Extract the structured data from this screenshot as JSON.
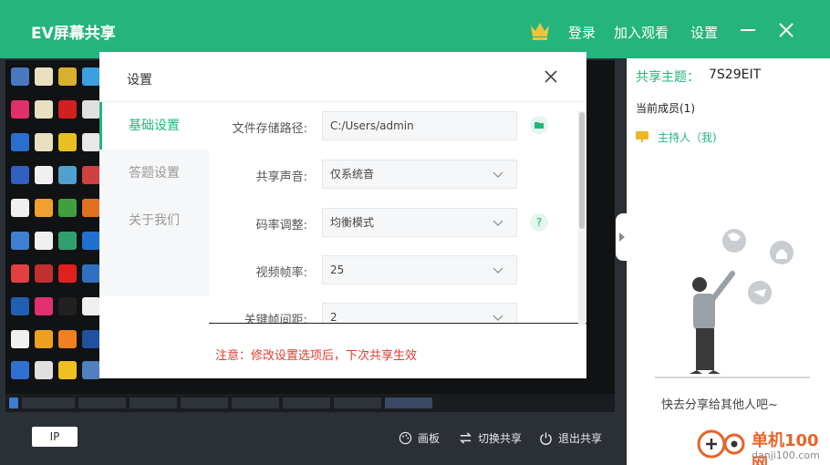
{
  "app": {
    "title": "EV屏幕共享",
    "login": "登录",
    "join_watch": "加入观看",
    "settings": "设置",
    "accent": "#23b57c"
  },
  "dialog": {
    "title": "设置",
    "nav": [
      "基础设置",
      "答题设置",
      "关于我们"
    ],
    "fields": {
      "path_label": "文件存储路径:",
      "path_value": "C:/Users/admin",
      "audio_label": "共享声音:",
      "audio_value": "仅系统音",
      "bitrate_label": "码率调整:",
      "bitrate_value": "均衡模式",
      "fps_label": "视频帧率:",
      "fps_value": "25",
      "keyframe_label": "关键帧间距:",
      "keyframe_value": "2"
    },
    "help": "?",
    "notice": "注意：修改设置选项后，下次共享生效",
    "notice_color": "#e03c31"
  },
  "bottombar": {
    "ip": "IP",
    "draw": "画板",
    "switch": "切换共享",
    "exit": "退出共享"
  },
  "side": {
    "topic_label": "共享主题：",
    "topic_code": "7S29EIT",
    "members": "当前成员(1)",
    "host": "主持人（我)",
    "share_prompt": "快去分享给其他人吧~"
  },
  "watermark": {
    "brand": "单机100网",
    "url": "danji100.com"
  }
}
